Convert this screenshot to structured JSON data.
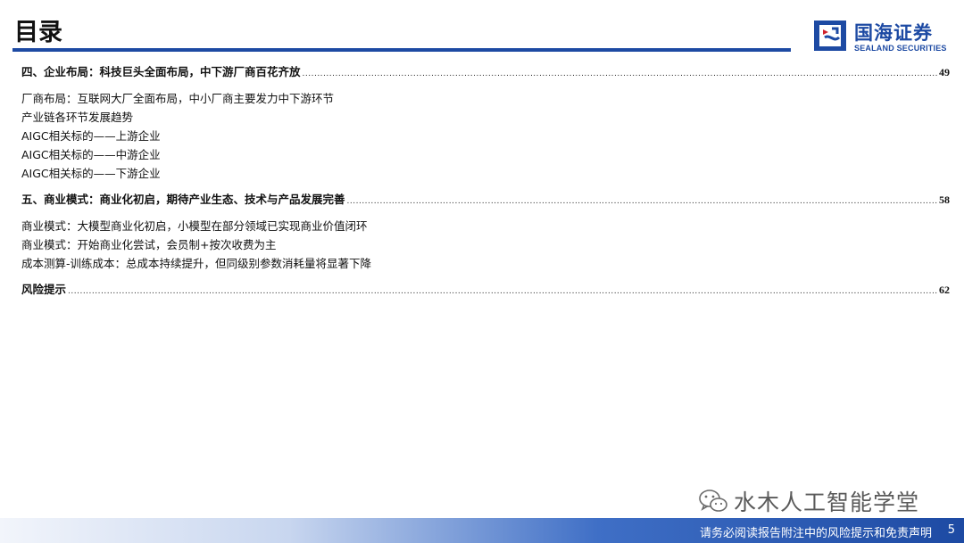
{
  "header": {
    "title": "目录",
    "brand_cn": "国海证券",
    "brand_en": "SEALAND SECURITIES",
    "accent_color": "#1d4aa3"
  },
  "toc": {
    "sections": [
      {
        "label": "四、企业布局：科技巨头全面布局，中下游厂商百花齐放",
        "page": "49",
        "items": [
          "厂商布局：互联网大厂全面布局，中小厂商主要发力中下游环节",
          "产业链各环节发展趋势",
          "AIGC相关标的——上游企业",
          "AIGC相关标的——中游企业",
          "AIGC相关标的——下游企业"
        ]
      },
      {
        "label": "五、商业模式：商业化初启，期待产业生态、技术与产品发展完善",
        "page": "58",
        "items": [
          "商业模式：大模型商业化初启，小模型在部分领域已实现商业价值闭环",
          "商业模式：开始商业化尝试，会员制+按次收费为主",
          "成本测算-训练成本：总成本持续提升，但同级别参数消耗量将显著下降"
        ]
      },
      {
        "label": "风险提示",
        "page": "62",
        "items": []
      }
    ]
  },
  "watermark": {
    "icon": "wechat-icon",
    "text": "水木人工智能学堂"
  },
  "footer": {
    "disclaimer": "请务必阅读报告附注中的风险提示和免责声明",
    "page_number": "5"
  }
}
